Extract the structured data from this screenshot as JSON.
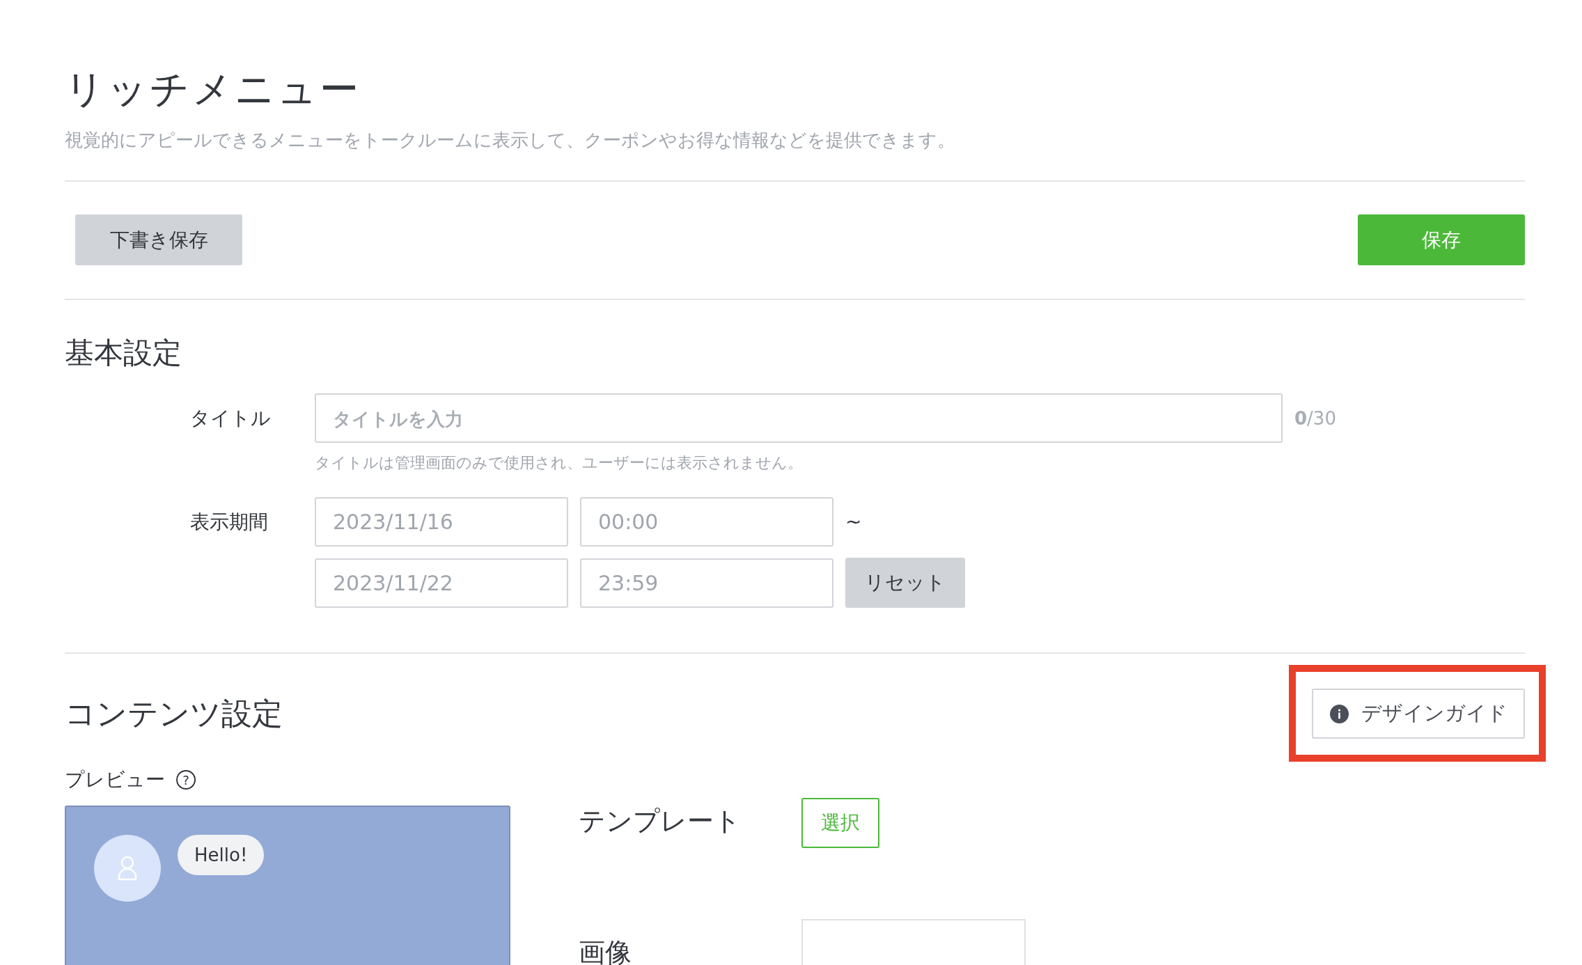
{
  "header": {
    "title": "リッチメニュー",
    "description": "視覚的にアピールできるメニューをトークルームに表示して、クーポンやお得な情報などを提供できます。"
  },
  "actions": {
    "draft_button": "下書き保存",
    "save_button": "保存"
  },
  "basic_settings": {
    "heading": "基本設定",
    "title_field": {
      "label": "タイトル",
      "placeholder": "タイトルを入力",
      "count": "0",
      "limit": "/30",
      "hint": "タイトルは管理画面のみで使用され、ユーザーには表示されません。"
    },
    "period": {
      "label": "表示期間",
      "start_date": "2023/11/16",
      "start_time": "00:00",
      "separator": "~",
      "end_date": "2023/11/22",
      "end_time": "23:59",
      "reset_button": "リセット"
    }
  },
  "content_settings": {
    "heading": "コンテンツ設定",
    "design_guide_button": {
      "label": "デザインガイド",
      "highlighted": true
    },
    "preview": {
      "label": "プレビュー",
      "help": "?",
      "bubble": "Hello!"
    },
    "template": {
      "label": "テンプレート",
      "select_button": "選択"
    },
    "image": {
      "label": "画像"
    }
  }
}
